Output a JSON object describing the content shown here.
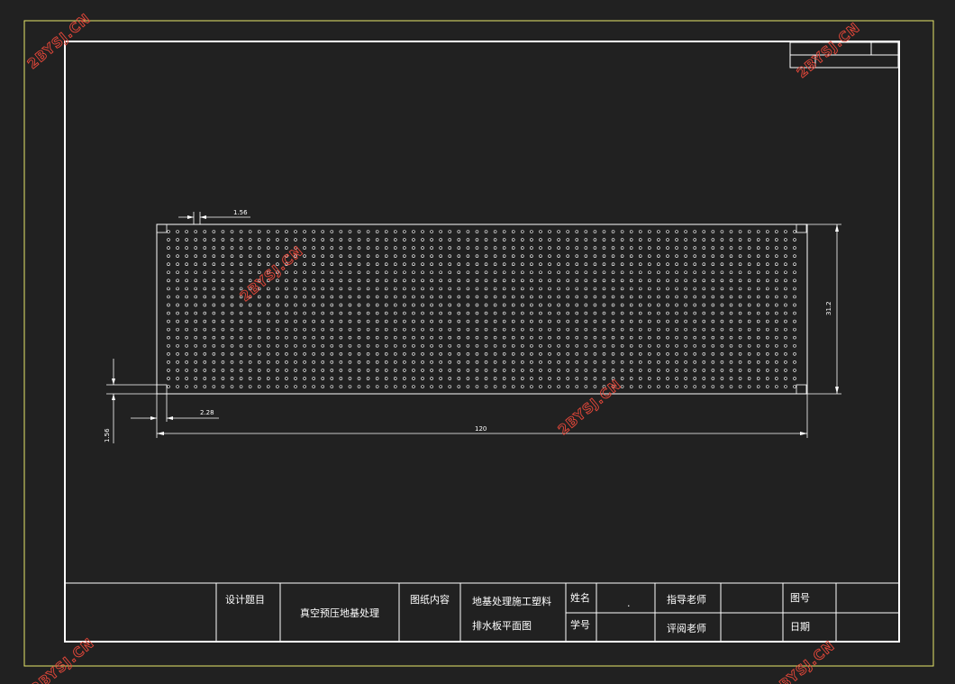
{
  "colors": {
    "background": "#212121",
    "outer_border": "#e6e66a",
    "lines": "#ffffff",
    "watermark": "#e8483a"
  },
  "plate": {
    "dimensions": {
      "hole_spacing": "1.56",
      "height": "31.2",
      "length": "120",
      "edge_offset": "2.28",
      "edge_spacing": "1.56"
    },
    "hole_columns": 70,
    "hole_rows": 20
  },
  "title_block": {
    "design_topic_label": "设计题目",
    "design_topic_value": "真空预压地基处理",
    "drawing_content_label": "图纸内容",
    "drawing_content_line1": "地基处理施工塑料",
    "drawing_content_line2": "排水板平面图",
    "name_label": "姓名",
    "name_value": ".",
    "student_id_label": "学号",
    "advisor_label": "指导老师",
    "reviewer_label": "评阅老师",
    "drawing_no_label": "图号",
    "date_label": "日期"
  },
  "watermark": {
    "text": "2BYSJ.CN"
  }
}
